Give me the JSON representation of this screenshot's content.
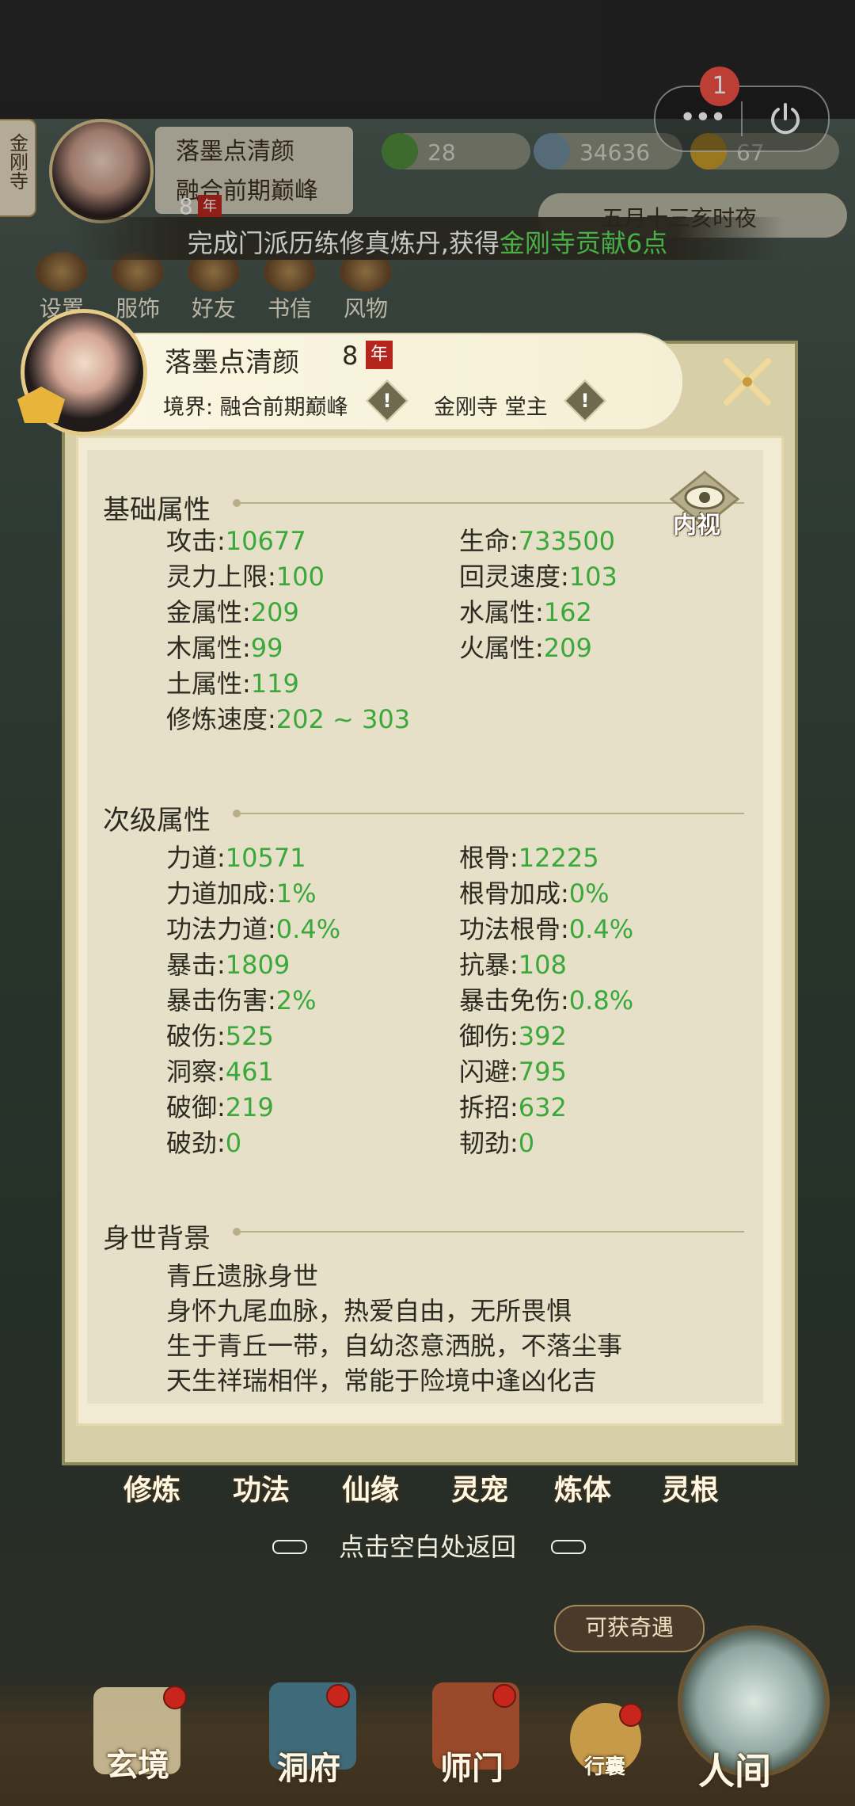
{
  "hud": {
    "sect_label": "金刚寺",
    "name": "落墨点清颜",
    "realm": "融合前期巅峰",
    "level": "8",
    "year_badge": "年",
    "resources": [
      {
        "name": "leaf",
        "value": "28"
      },
      {
        "name": "coin",
        "value": "34636"
      },
      {
        "name": "gold",
        "value": "67"
      }
    ],
    "date": "五月十三亥时夜"
  },
  "capsule": {
    "notification_count": "1"
  },
  "toast": {
    "prefix": "完成门派历练修真炼丹,获得",
    "highlight": "金刚寺贡献6点"
  },
  "menu": [
    "设置",
    "服饰",
    "好友",
    "书信",
    "风物"
  ],
  "panel": {
    "name": "落墨点清颜",
    "level": "8",
    "year_badge": "年",
    "realm": "境界: 融合前期巅峰",
    "sect": "金刚寺 堂主",
    "inner_view": "内视",
    "basic_title": "基础属性",
    "basic": [
      {
        "label": "攻击:",
        "value": "10677"
      },
      {
        "label": "生命:",
        "value": "733500"
      },
      {
        "label": "灵力上限:",
        "value": "100"
      },
      {
        "label": "回灵速度:",
        "value": "103"
      },
      {
        "label": "金属性:",
        "value": "209"
      },
      {
        "label": "水属性:",
        "value": "162"
      },
      {
        "label": "木属性:",
        "value": "99"
      },
      {
        "label": "火属性:",
        "value": "209"
      },
      {
        "label": "土属性:",
        "value": "119"
      },
      {
        "label": "修炼速度:",
        "value": "202 ~ 303"
      }
    ],
    "secondary_title": "次级属性",
    "secondary": [
      {
        "label": "力道:",
        "value": "10571"
      },
      {
        "label": "根骨:",
        "value": "12225"
      },
      {
        "label": "力道加成:",
        "value": "1%"
      },
      {
        "label": "根骨加成:",
        "value": "0%"
      },
      {
        "label": "功法力道:",
        "value": "0.4%"
      },
      {
        "label": "功法根骨:",
        "value": "0.4%"
      },
      {
        "label": "暴击:",
        "value": "1809"
      },
      {
        "label": "抗暴:",
        "value": "108"
      },
      {
        "label": "暴击伤害:",
        "value": "2%"
      },
      {
        "label": "暴击免伤:",
        "value": "0.8%"
      },
      {
        "label": "破伤:",
        "value": "525"
      },
      {
        "label": "御伤:",
        "value": "392"
      },
      {
        "label": "洞察:",
        "value": "461"
      },
      {
        "label": "闪避:",
        "value": "795"
      },
      {
        "label": "破御:",
        "value": "219"
      },
      {
        "label": "拆招:",
        "value": "632"
      },
      {
        "label": "破劲:",
        "value": "0"
      },
      {
        "label": "韧劲:",
        "value": "0"
      }
    ],
    "background_title": "身世背景",
    "background": [
      "青丘遗脉身世",
      "身怀九尾血脉，热爱自由，无所畏惧",
      "生于青丘一带，自幼恣意洒脱，不落尘事",
      "天生祥瑞相伴，常能于险境中逢凶化吉"
    ]
  },
  "tabs": [
    "修炼",
    "功法",
    "仙缘",
    "灵宠",
    "炼体",
    "灵根"
  ],
  "hint": "点击空白处返回",
  "adventure_button": "可获奇遇",
  "nav": [
    "玄境",
    "洞府",
    "师门",
    "行囊",
    "人间"
  ],
  "colors": {
    "value_green": "#3aa83a",
    "highlight_green": "#5fe05a",
    "badge_red": "#b4261d"
  }
}
